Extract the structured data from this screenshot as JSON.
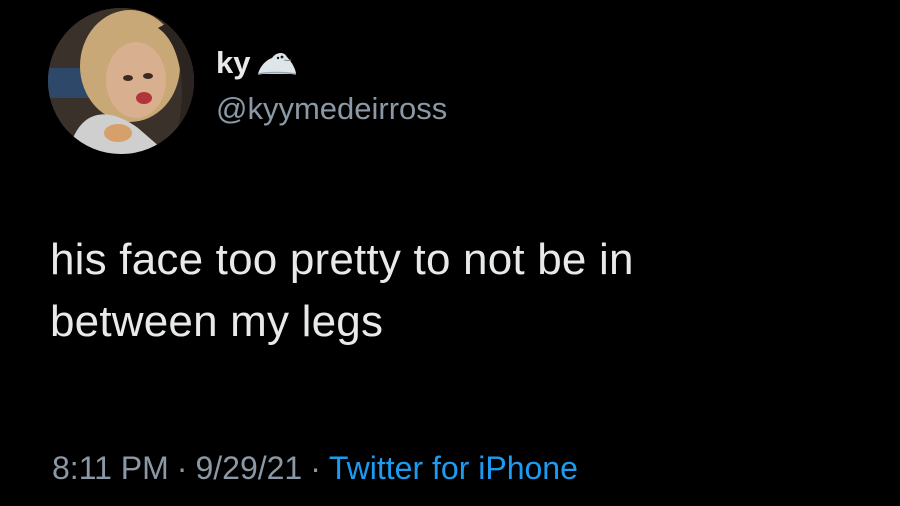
{
  "user": {
    "display_name": "ky",
    "emoji_icon": "seal-icon",
    "handle": "@kyymedeirross"
  },
  "tweet": {
    "line1": "his face too pretty to not be in",
    "line2": "between my legs"
  },
  "meta": {
    "time": "8:11 PM",
    "separator": "·",
    "date": "9/29/21",
    "source": "Twitter for iPhone"
  },
  "colors": {
    "background": "#000000",
    "primary_text": "#e7e9ea",
    "secondary_text": "#8b98a5",
    "link": "#1d9bf0"
  }
}
